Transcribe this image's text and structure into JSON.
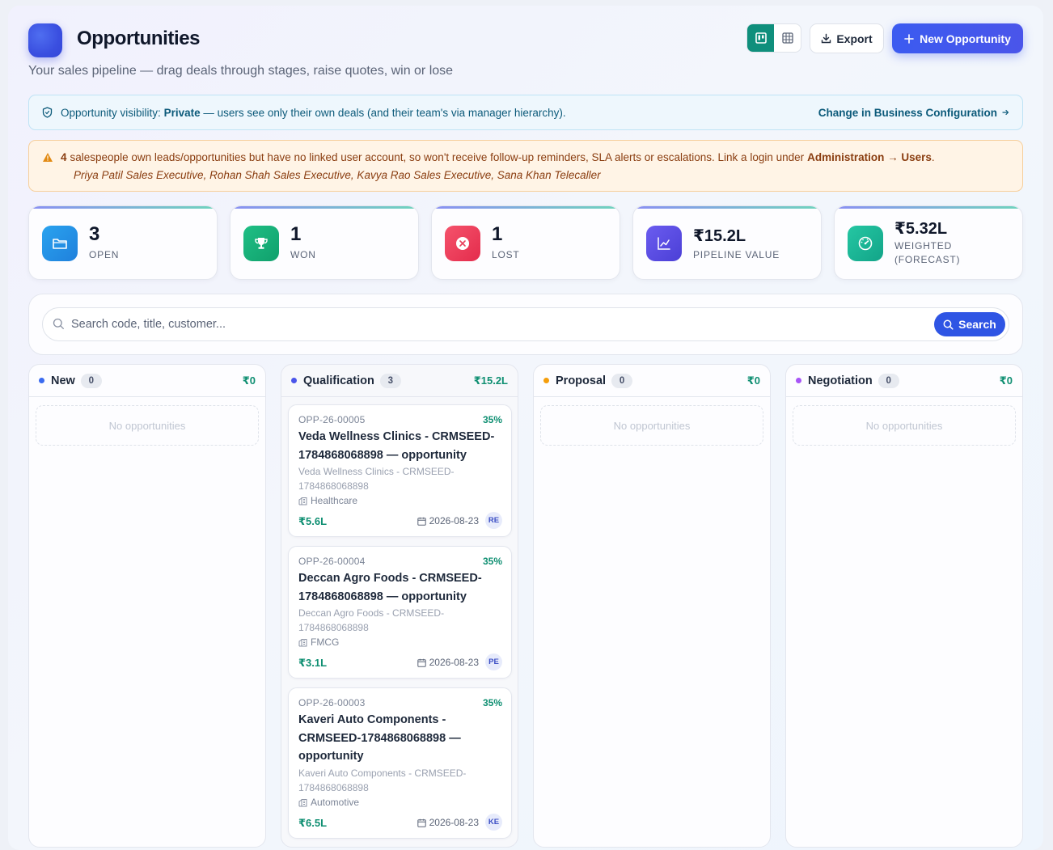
{
  "header": {
    "title": "Opportunities",
    "subtitle": "Your sales pipeline — drag deals through stages, raise quotes, win or lose",
    "export_label": "Export",
    "new_label": "New Opportunity",
    "view_active": "board"
  },
  "visibility": {
    "prefix": "Opportunity visibility:",
    "mode": "Private",
    "suffix": "— users see only their own deals (and their team's via manager hierarchy).",
    "link": "Change in Business Configuration"
  },
  "warning": {
    "count": "4",
    "text": "salespeople own leads/opportunities but have no linked user account, so won't receive follow-up reminders, SLA alerts or escalations. Link a login under",
    "link": "Administration → Users",
    "end": ".",
    "people": "Priya Patil Sales Executive, Rohan Shah Sales Executive, Kavya Rao Sales Executive, Sana Khan Telecaller"
  },
  "stats": [
    {
      "value": "3",
      "label": "OPEN",
      "icon": "folder-icon",
      "color": "#2a93e8"
    },
    {
      "value": "1",
      "label": "WON",
      "icon": "trophy-icon",
      "color": "#16b07a"
    },
    {
      "value": "1",
      "label": "LOST",
      "icon": "x-circle-icon",
      "color": "#ef3e5a"
    },
    {
      "value": "₹15.2L",
      "label": "PIPELINE VALUE",
      "icon": "trend-chart-icon",
      "color": "#5a4fe0"
    },
    {
      "value": "₹5.32L",
      "label": "WEIGHTED (FORECAST)",
      "icon": "gauge-icon",
      "color": "#1cb89a"
    }
  ],
  "search": {
    "placeholder": "Search code, title, customer...",
    "value": "",
    "button": "Search"
  },
  "columns": [
    {
      "name": "New",
      "count": "0",
      "total": "₹0",
      "dot": "#3b6bf0",
      "empty": "No opportunities"
    },
    {
      "name": "Qualification",
      "count": "3",
      "total": "₹15.2L",
      "dot": "#4a55ea",
      "empty": ""
    },
    {
      "name": "Proposal",
      "count": "0",
      "total": "₹0",
      "dot": "#f59e0b",
      "empty": "No opportunities"
    },
    {
      "name": "Negotiation",
      "count": "0",
      "total": "₹0",
      "dot": "#a855f7",
      "empty": "No opportunities"
    }
  ],
  "cards": [
    {
      "code": "OPP-26-00005",
      "prob": "35%",
      "title": "Veda Wellness Clinics - CRMSEED-1784868068898 — opportunity",
      "customer": "Veda Wellness Clinics - CRMSEED-1784868068898",
      "industry": "Healthcare",
      "value": "₹5.6L",
      "date": "2026-08-23",
      "owner": "RE"
    },
    {
      "code": "OPP-26-00004",
      "prob": "35%",
      "title": "Deccan Agro Foods - CRMSEED-1784868068898 — opportunity",
      "customer": "Deccan Agro Foods - CRMSEED-1784868068898",
      "industry": "FMCG",
      "value": "₹3.1L",
      "date": "2026-08-23",
      "owner": "PE"
    },
    {
      "code": "OPP-26-00003",
      "prob": "35%",
      "title": "Kaveri Auto Components - CRMSEED-1784868068898 — opportunity",
      "customer": "Kaveri Auto Components - CRMSEED-1784868068898",
      "industry": "Automotive",
      "value": "₹6.5L",
      "date": "2026-08-23",
      "owner": "KE"
    }
  ]
}
